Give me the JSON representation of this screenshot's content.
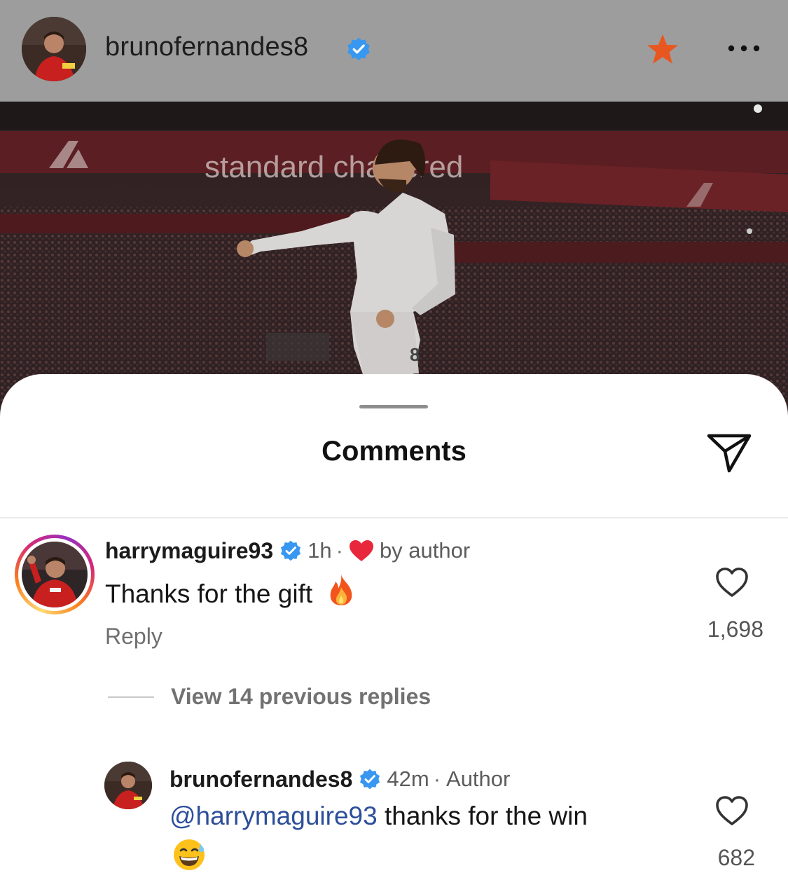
{
  "header": {
    "username": "brunofernandes8",
    "verified_icon": "verified-badge-icon",
    "favorite_icon": "star-icon",
    "more_icon": "more-options-icon"
  },
  "post": {
    "image_description_icon": "post-photo",
    "banner_text": "standard chartered"
  },
  "comments_sheet": {
    "title": "Comments",
    "share_icon": "paper-plane-icon",
    "comment": {
      "username": "harrymaguire93",
      "time": "1h",
      "separator": "·",
      "liked_by_author_label": "by author",
      "text": "Thanks for the gift",
      "emoji_icon": "fire-icon",
      "reply_label": "Reply",
      "like_count": "1,698"
    },
    "view_replies_label": "View 14 previous replies",
    "reply": {
      "username": "brunofernandes8",
      "time": "42m",
      "separator": "·",
      "role_label": "Author",
      "mention": "@harrymaguire93",
      "text": " thanks for the win",
      "emoji_icon": "grinning-sweat-icon",
      "like_count": "682"
    }
  },
  "colors": {
    "header_bg": "#9d9d9d",
    "verified_blue": "#3897f0",
    "star_orange": "#e8571f",
    "heart_red": "#e8273c",
    "mention_blue": "#2d4e9a"
  }
}
